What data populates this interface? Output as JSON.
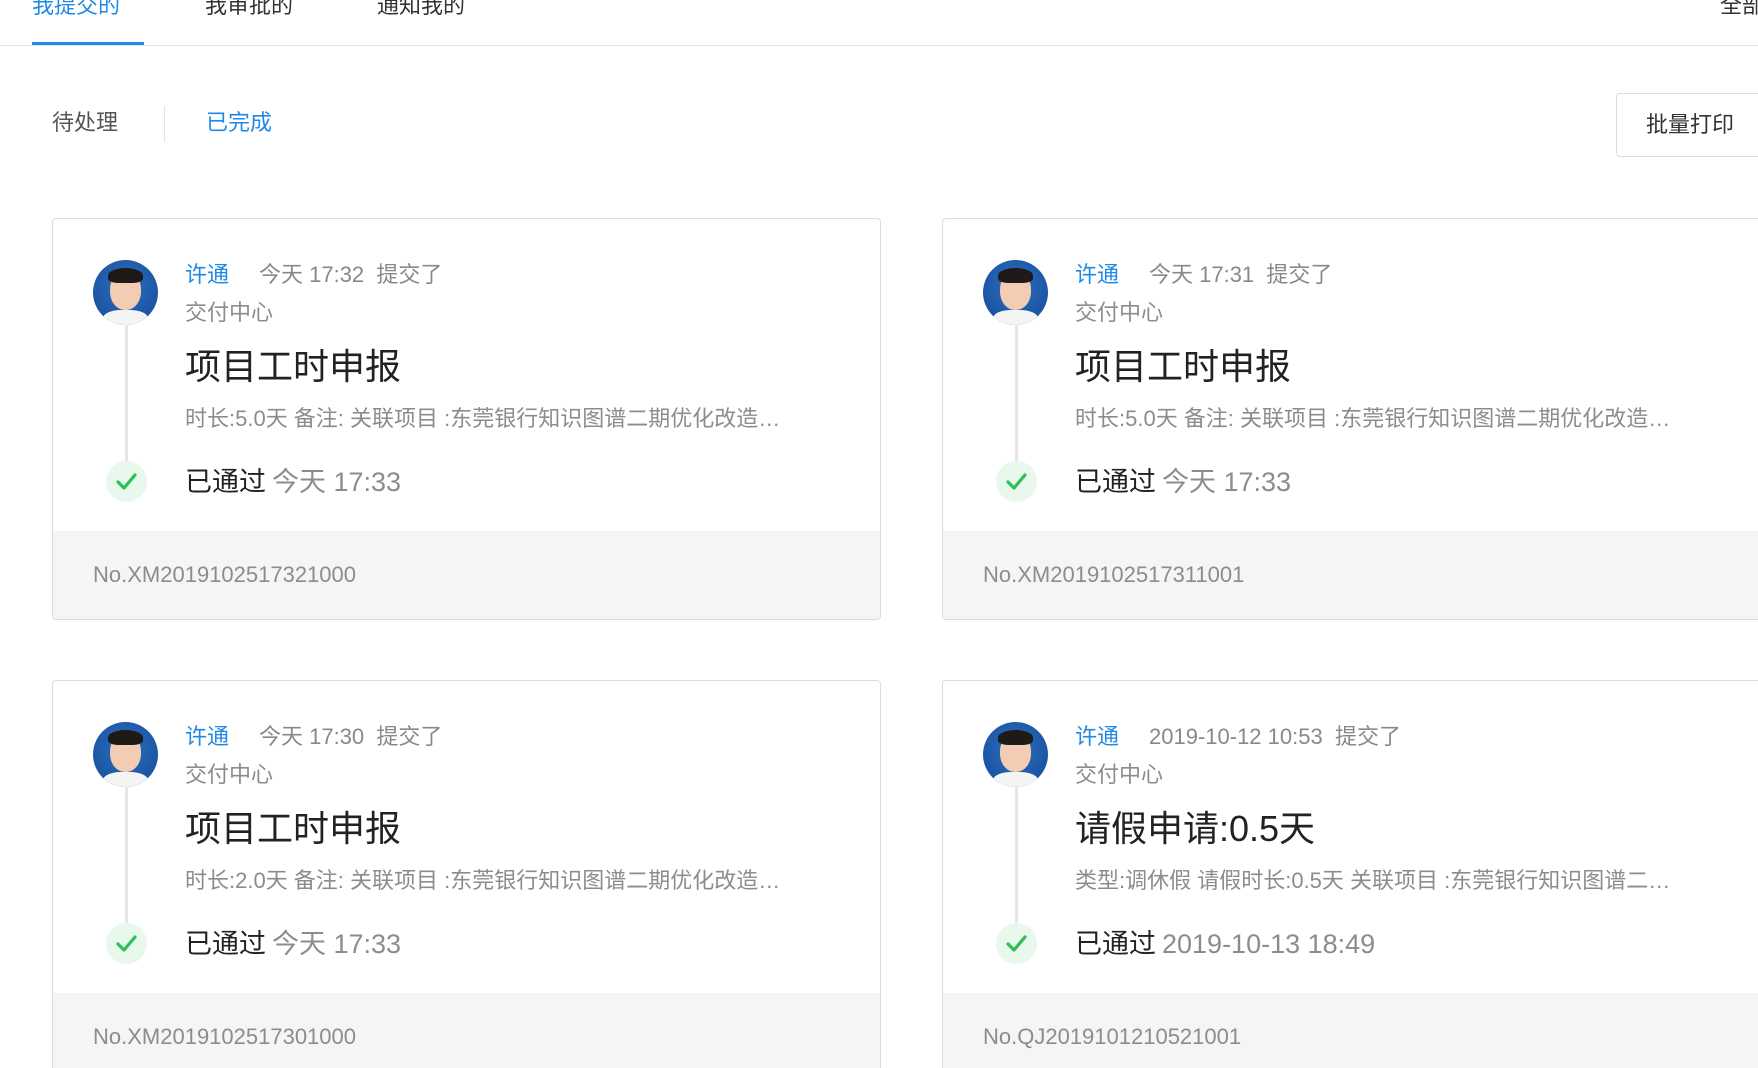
{
  "tabs": {
    "submitted": "我提交的",
    "approved": "我审批的",
    "notified": "通知我的",
    "right_cut": "全部"
  },
  "filters": {
    "pending": "待处理",
    "completed": "已完成",
    "batch_print": "批量打印"
  },
  "colors": {
    "accent": "#1f8ae6",
    "success": "#2fbf55"
  },
  "cards": [
    {
      "submitter": "许通",
      "submit_time": "今天 17:32",
      "submit_action": "提交了",
      "department": "交付中心",
      "title": "项目工时申报",
      "description": "时长:5.0天 备注: 关联项目 :东莞银行知识图谱二期优化改造…",
      "status": "已通过",
      "status_time": "今天 17:33",
      "number": "No.XM201910251732100​0"
    },
    {
      "submitter": "许通",
      "submit_time": "今天 17:31",
      "submit_action": "提交了",
      "department": "交付中心",
      "title": "项目工时申报",
      "description": "时长:5.0天 备注: 关联项目 :东莞银行知识图谱二期优化改造…",
      "status": "已通过",
      "status_time": "今天 17:33",
      "number": "No.XM2019102517311001"
    },
    {
      "submitter": "许通",
      "submit_time": "今天 17:30",
      "submit_action": "提交了",
      "department": "交付中心",
      "title": "项目工时申报",
      "description": "时长:2.0天 备注: 关联项目 :东莞银行知识图谱二期优化改造…",
      "status": "已通过",
      "status_time": "今天 17:33",
      "number": "No.XM2019102517301000"
    },
    {
      "submitter": "许通",
      "submit_time": "2019-10-12 10:53",
      "submit_action": "提交了",
      "department": "交付中心",
      "title": "请假申请:0.5天",
      "description": "类型:调休假 请假时长:0.5天 关联项目 :东莞银行知识图谱二…",
      "status": "已通过",
      "status_time": "2019-10-13 18:49",
      "number": "No.QJ2019101210521001"
    }
  ]
}
